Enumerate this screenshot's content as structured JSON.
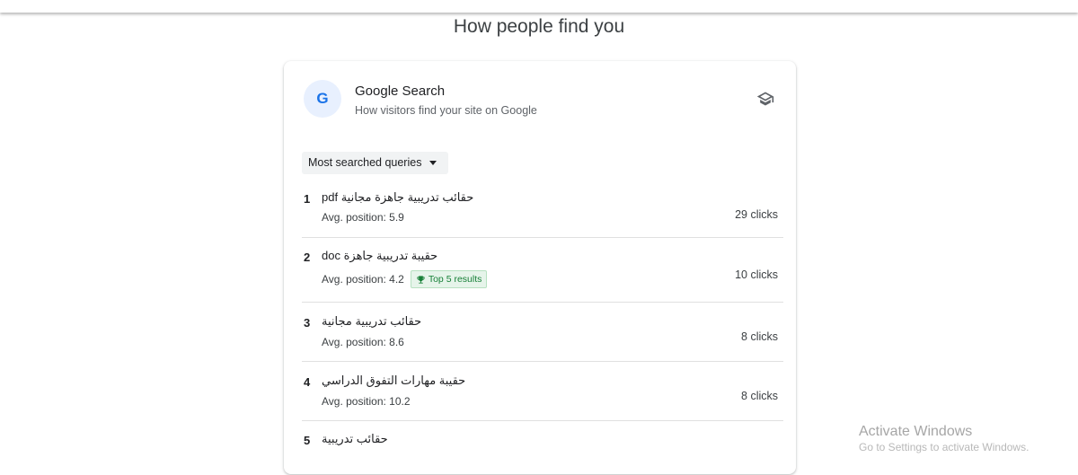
{
  "page": {
    "title": "How people find you"
  },
  "card": {
    "avatar_letter": "G",
    "title": "Google Search",
    "subtitle": "How visitors find your site on Google",
    "learn_icon": "school-icon",
    "dropdown_label": "Most searched queries"
  },
  "queries": [
    {
      "rank": "1",
      "text": "حقائب تدريبية جاهزة مجانية pdf",
      "position": "Avg. position: 5.9",
      "badge": "",
      "clicks": "29 clicks"
    },
    {
      "rank": "2",
      "text": "حقيبة تدريبية جاهزة doc",
      "position": "Avg. position: 4.2",
      "badge": "Top 5 results",
      "clicks": "10 clicks"
    },
    {
      "rank": "3",
      "text": "حقائب تدريبية مجانية",
      "position": "Avg. position: 8.6",
      "badge": "",
      "clicks": "8 clicks"
    },
    {
      "rank": "4",
      "text": "حقيبة مهارات التفوق الدراسي",
      "position": "Avg. position: 10.2",
      "badge": "",
      "clicks": "8 clicks"
    },
    {
      "rank": "5",
      "text": "حقائب تدريبية",
      "position": "",
      "badge": "",
      "clicks": ""
    }
  ],
  "watermark": {
    "line1": "Activate Windows",
    "line2": "Go to Settings to activate Windows."
  },
  "colors": {
    "accent": "#1a73e8",
    "avatar_bg": "#e8f0fe",
    "badge_green": "#188038",
    "badge_bg": "#e6f4ea"
  }
}
